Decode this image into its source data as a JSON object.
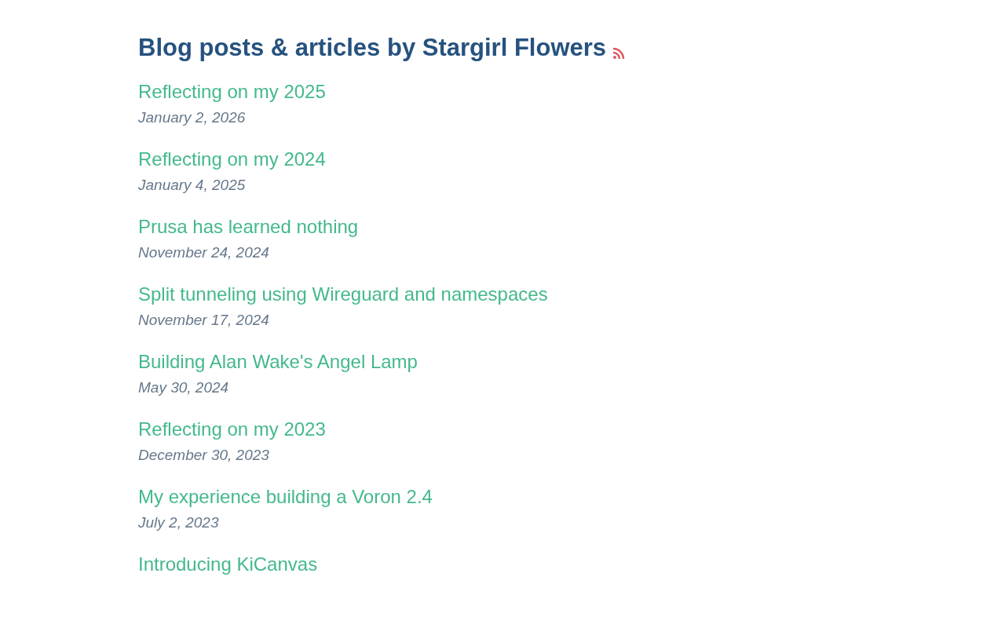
{
  "heading": {
    "title": "Blog posts & articles by Stargirl Flowers"
  },
  "posts": [
    {
      "title": "Reflecting on my 2025",
      "date": "January 2, 2026"
    },
    {
      "title": "Reflecting on my 2024",
      "date": "January 4, 2025"
    },
    {
      "title": "Prusa has learned nothing",
      "date": "November 24, 2024"
    },
    {
      "title": "Split tunneling using Wireguard and namespaces",
      "date": "November 17, 2024"
    },
    {
      "title": "Building Alan Wake's Angel Lamp",
      "date": "May 30, 2024"
    },
    {
      "title": "Reflecting on my 2023",
      "date": "December 30, 2023"
    },
    {
      "title": "My experience building a Voron 2.4",
      "date": "July 2, 2023"
    },
    {
      "title": "Introducing KiCanvas"
    }
  ]
}
